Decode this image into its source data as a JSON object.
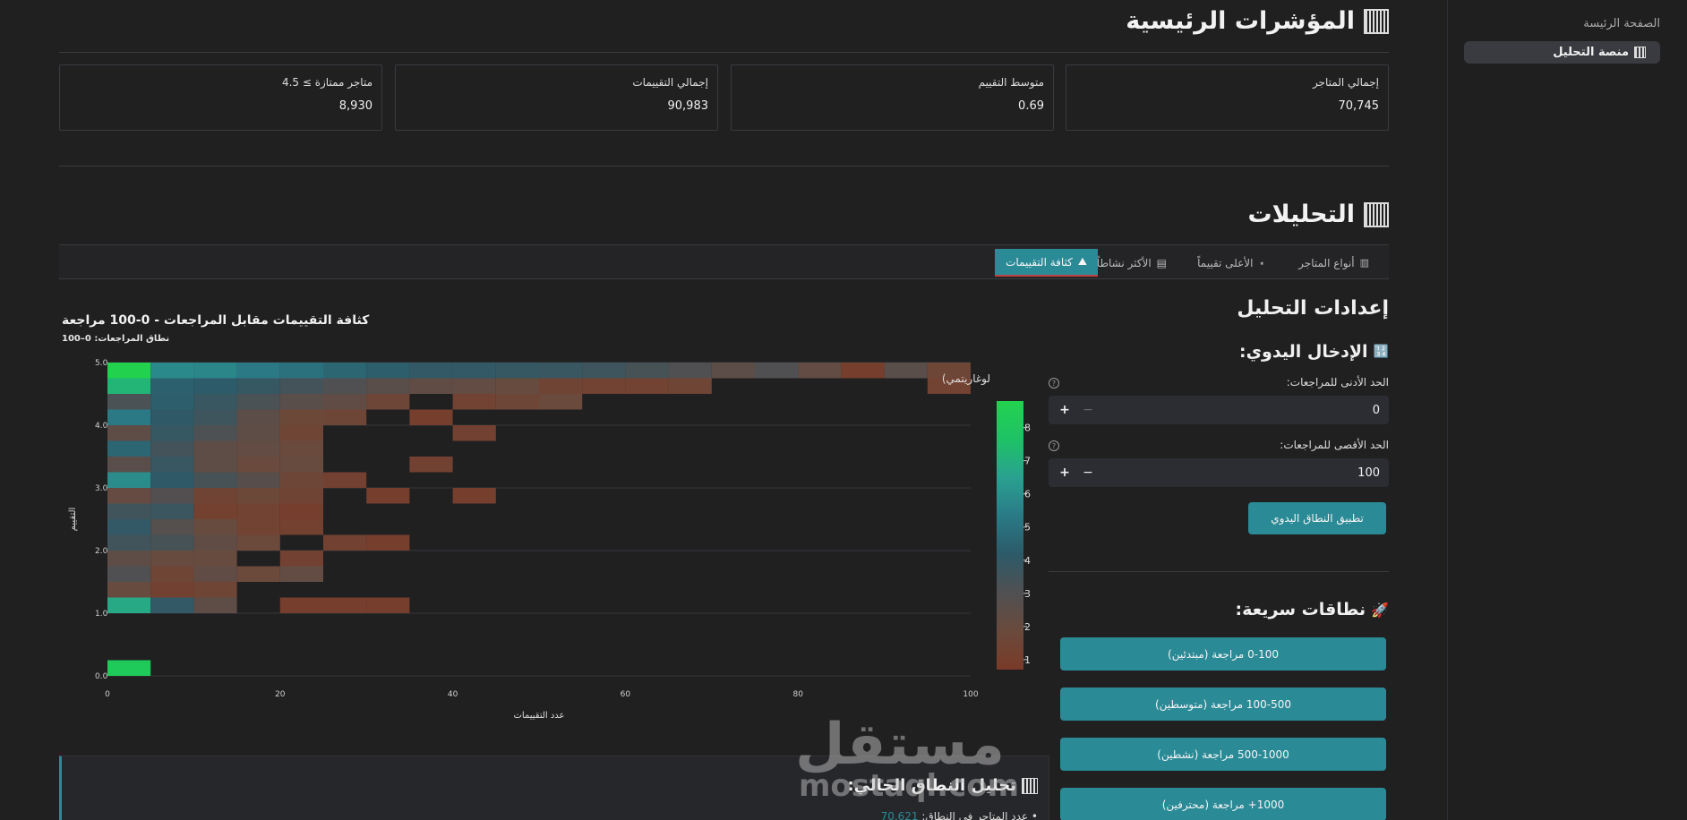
{
  "sidebar": {
    "home": "الصفحة الرئيسة",
    "active": "منصة التحليل"
  },
  "kpi": {
    "title": "المؤشرات الرئيسية",
    "metrics": [
      {
        "label": "إجمالي المتاجر",
        "value": "70,745"
      },
      {
        "label": "متوسط التقييم",
        "value": "0.69"
      },
      {
        "label": "إجمالي التقييمات",
        "value": "90,983"
      },
      {
        "label": "متاجر ممتازة ≥ 4.5",
        "value": "8,930"
      }
    ]
  },
  "analytics": {
    "title": "التحليلات",
    "tabs": [
      {
        "label": "أنواع المتاجر",
        "icon": "chart-icon"
      },
      {
        "label": "الأعلى تقييماً",
        "icon": "star-icon"
      },
      {
        "label": "الأكثر نشاطاً",
        "icon": "document-icon"
      },
      {
        "label": "كثافة التقييمات",
        "icon": "mountain-icon"
      }
    ],
    "active_tab": 3
  },
  "settings": {
    "title": "إعدادات التحليل",
    "manual_title": "الإدخال اليدوي:",
    "min_label": "الحد الأدنى للمراجعات:",
    "min_value": "0",
    "max_label": "الحد الأقصى للمراجعات:",
    "max_value": "100",
    "apply_label": "تطبيق النطاق اليدوي",
    "quick_title": "نطاقات سريعة:",
    "quick_ranges": [
      "0-100 مراجعة (مبتدئين)",
      "100-500 مراجعة (متوسطين)",
      "500-1000 مراجعة (نشطين)",
      "1000+ مراجعة (محترفين)"
    ]
  },
  "analysis": {
    "title": "تحليل النطاق الحالي:",
    "line_label": "عدد المتاجر في النطاق:",
    "line_value": "70,621"
  },
  "watermark": {
    "ar": "مستقل",
    "en": "mostaql.com"
  },
  "chart_data": {
    "type": "heatmap",
    "title": "كثافة التقييمات مقابل المراجعات - 0-100 مراجعة",
    "subtitle": "نطاق المراجعات: 0–100",
    "xlabel": "عدد التقييمات",
    "ylabel": "التقييم",
    "xlim": [
      0,
      100
    ],
    "ylim": [
      0,
      5
    ],
    "x_ticks": [
      0,
      20,
      40,
      60,
      80,
      100
    ],
    "y_ticks": [
      "0.0",
      "1.0",
      "2.0",
      "3.0",
      "4.0",
      "5.0"
    ],
    "colorbar_label": "لوغاريتمي)",
    "colorbar_ticks": [
      1,
      2,
      3,
      4,
      5,
      6,
      7,
      8
    ],
    "colorbar_range": [
      0.7,
      8.8
    ],
    "x_bin_width": 5,
    "y_bin_height": 0.25,
    "cells": [
      [
        0,
        4.75,
        8.8
      ],
      [
        5,
        4.75,
        5.8
      ],
      [
        10,
        4.75,
        5.7
      ],
      [
        15,
        4.75,
        5.3
      ],
      [
        20,
        4.75,
        5.0
      ],
      [
        25,
        4.75,
        4.6
      ],
      [
        30,
        4.75,
        4.3
      ],
      [
        35,
        4.75,
        4.0
      ],
      [
        40,
        4.75,
        4.0
      ],
      [
        45,
        4.75,
        3.9
      ],
      [
        50,
        4.75,
        3.8
      ],
      [
        55,
        4.75,
        3.6
      ],
      [
        60,
        4.75,
        3.3
      ],
      [
        65,
        4.75,
        3.0
      ],
      [
        70,
        4.75,
        2.5
      ],
      [
        75,
        4.75,
        3.0
      ],
      [
        80,
        4.75,
        2.2
      ],
      [
        85,
        4.75,
        1.0
      ],
      [
        90,
        4.75,
        2.6
      ],
      [
        95,
        4.75,
        1.6
      ],
      [
        100,
        4.75,
        2.0
      ],
      [
        0,
        4.5,
        7.2
      ],
      [
        5,
        4.5,
        4.4
      ],
      [
        10,
        4.5,
        4.2
      ],
      [
        15,
        4.5,
        3.9
      ],
      [
        20,
        4.5,
        3.4
      ],
      [
        25,
        4.5,
        3.0
      ],
      [
        30,
        4.5,
        2.6
      ],
      [
        35,
        4.5,
        2.3
      ],
      [
        40,
        4.5,
        2.2
      ],
      [
        45,
        4.5,
        2.0
      ],
      [
        50,
        4.5,
        1.4
      ],
      [
        55,
        4.5,
        1.3
      ],
      [
        60,
        4.5,
        1.3
      ],
      [
        65,
        4.5,
        1.5
      ],
      [
        95,
        4.5,
        1.3
      ],
      [
        0,
        4.25,
        3.2
      ],
      [
        5,
        4.25,
        4.3
      ],
      [
        10,
        4.25,
        3.8
      ],
      [
        15,
        4.25,
        3.2
      ],
      [
        20,
        4.25,
        2.6
      ],
      [
        25,
        4.25,
        2.3
      ],
      [
        30,
        4.25,
        1.6
      ],
      [
        40,
        4.25,
        1.3
      ],
      [
        45,
        4.25,
        1.6
      ],
      [
        50,
        4.25,
        1.9
      ],
      [
        0,
        4.0,
        5.3
      ],
      [
        5,
        4.0,
        4.1
      ],
      [
        10,
        4.0,
        3.6
      ],
      [
        15,
        4.0,
        2.5
      ],
      [
        20,
        4.0,
        1.7
      ],
      [
        25,
        4.0,
        1.6
      ],
      [
        35,
        4.0,
        1.0
      ],
      [
        0,
        3.75,
        2.4
      ],
      [
        5,
        3.75,
        3.9
      ],
      [
        10,
        3.75,
        3.1
      ],
      [
        15,
        3.75,
        2.4
      ],
      [
        20,
        3.75,
        1.5
      ],
      [
        40,
        3.75,
        1.2
      ],
      [
        0,
        3.5,
        4.6
      ],
      [
        5,
        3.5,
        3.4
      ],
      [
        10,
        3.5,
        2.4
      ],
      [
        15,
        3.5,
        2.2
      ],
      [
        20,
        3.5,
        1.9
      ],
      [
        0,
        3.25,
        2.6
      ],
      [
        5,
        3.25,
        3.8
      ],
      [
        10,
        3.25,
        2.4
      ],
      [
        15,
        3.25,
        1.9
      ],
      [
        20,
        3.25,
        2.0
      ],
      [
        35,
        3.25,
        1.2
      ],
      [
        0,
        3.0,
        5.9
      ],
      [
        5,
        3.0,
        4.1
      ],
      [
        10,
        3.0,
        3.3
      ],
      [
        15,
        3.0,
        2.7
      ],
      [
        20,
        3.0,
        1.6
      ],
      [
        25,
        3.0,
        1.2
      ],
      [
        0,
        2.75,
        2.1
      ],
      [
        5,
        2.75,
        2.9
      ],
      [
        10,
        2.75,
        1.4
      ],
      [
        15,
        2.75,
        1.7
      ],
      [
        20,
        2.75,
        1.4
      ],
      [
        30,
        2.75,
        1.0
      ],
      [
        40,
        2.75,
        1.0
      ],
      [
        0,
        2.5,
        3.5
      ],
      [
        5,
        2.5,
        3.7
      ],
      [
        10,
        2.5,
        1.1
      ],
      [
        15,
        2.5,
        1.3
      ],
      [
        20,
        2.5,
        1.0
      ],
      [
        0,
        2.25,
        4.0
      ],
      [
        5,
        2.25,
        2.8
      ],
      [
        10,
        2.25,
        2.0
      ],
      [
        15,
        2.25,
        1.3
      ],
      [
        20,
        2.25,
        1.1
      ],
      [
        0,
        2.0,
        3.5
      ],
      [
        5,
        2.0,
        3.3
      ],
      [
        10,
        2.0,
        2.3
      ],
      [
        15,
        2.0,
        1.8
      ],
      [
        25,
        2.0,
        1.2
      ],
      [
        30,
        2.0,
        1.0
      ],
      [
        0,
        1.75,
        2.4
      ],
      [
        5,
        1.75,
        2.0
      ],
      [
        10,
        1.75,
        2.0
      ],
      [
        20,
        1.75,
        1.2
      ],
      [
        0,
        1.5,
        3.0
      ],
      [
        5,
        1.5,
        1.5
      ],
      [
        10,
        1.5,
        2.3
      ],
      [
        15,
        1.5,
        1.8
      ],
      [
        20,
        1.5,
        2.2
      ],
      [
        0,
        1.25,
        2.0
      ],
      [
        5,
        1.25,
        1.2
      ],
      [
        10,
        1.25,
        1.5
      ],
      [
        0,
        1.0,
        6.8
      ],
      [
        5,
        1.0,
        4.0
      ],
      [
        10,
        1.0,
        2.4
      ],
      [
        20,
        1.0,
        1.0
      ],
      [
        25,
        1.0,
        1.0
      ],
      [
        30,
        1.0,
        1.0
      ],
      [
        0,
        0.0,
        8.2
      ]
    ]
  },
  "colors": {
    "accent": "#2a8a96",
    "background": "#202021",
    "colormap": [
      "#7a3a28",
      "#6a4a3c",
      "#505052",
      "#2d5a68",
      "#2a7a86",
      "#2aa090",
      "#1ec266",
      "#22d24e"
    ]
  }
}
